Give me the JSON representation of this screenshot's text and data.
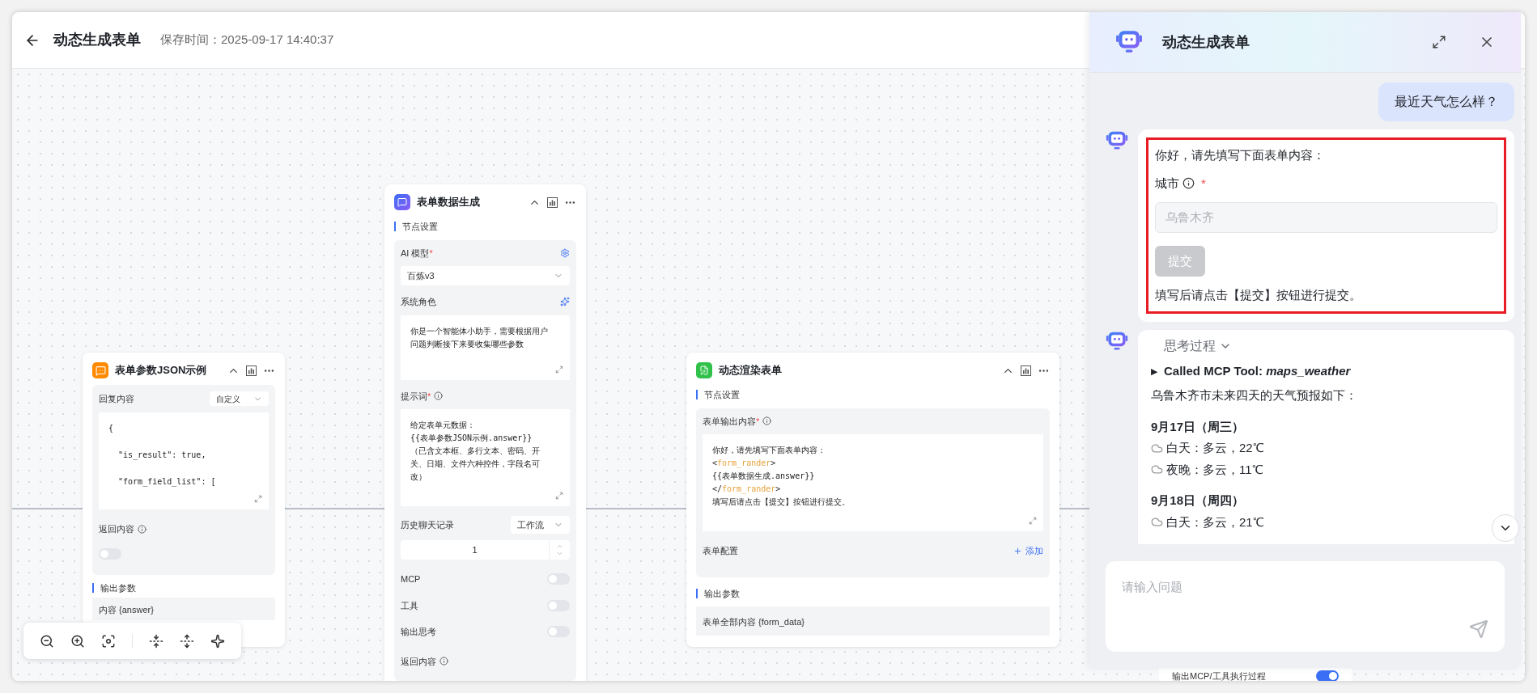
{
  "header": {
    "title": "动态生成表单",
    "saved_time": "保存时间：2025-09-17 14:40:37"
  },
  "json_example_node": {
    "title": "表单参数JSON示例",
    "reply_label": "回复内容",
    "reply_mode": "自定义",
    "code_lines": [
      "{",
      "  \"is_result\": true,",
      "  \"form_field_list\": ["
    ],
    "return_label": "返回内容",
    "return_on": false,
    "output_section": "输出参数",
    "output_param": "内容 {answer}"
  },
  "data_gen_node": {
    "title": "表单数据生成",
    "section": "节点设置",
    "model_label": "AI 模型",
    "model_required": "*",
    "model": "百炼v3",
    "role_label": "系统角色",
    "role_text": "你是一个智能体小助手，需要根据用户问题判断接下来要收集哪些参数",
    "prompt_label": "提示词",
    "prompt_required": "*",
    "prompt_lines": [
      "给定表单元数据：",
      "{{表单参数JSON示例.answer}}",
      "（已含文本框、多行文本、密码、开关、日期、文件六种控件，字段名可改）"
    ],
    "history_label": "历史聊天记录",
    "history_mode": "工作流",
    "history_count": "1",
    "switches": [
      {
        "label": "MCP",
        "on": false
      },
      {
        "label": "工具",
        "on": false
      },
      {
        "label": "输出思考",
        "on": false
      }
    ],
    "return_label": "返回内容"
  },
  "render_node": {
    "title": "动态渲染表单",
    "section": "节点设置",
    "content_label": "表单输出内容",
    "content_required": "*",
    "content_lines": [
      [
        {
          "text": "你好，请先填写下面表单内容：",
          "highlight": false
        }
      ],
      [
        {
          "text": "<",
          "highlight": false
        },
        {
          "text": "form_rander",
          "highlight": true
        },
        {
          "text": ">",
          "highlight": false
        }
      ],
      [
        {
          "text": "{{表单数据生成.answer}}",
          "highlight": false
        }
      ],
      [
        {
          "text": "</",
          "highlight": false
        },
        {
          "text": "form_rander",
          "highlight": true
        },
        {
          "text": ">",
          "highlight": false
        }
      ],
      [
        {
          "text": "填写后请点击【提交】按钮进行提交。",
          "highlight": false
        }
      ]
    ],
    "config_label": "表单配置",
    "add_label": "添加",
    "output_section": "输出参数",
    "output_param": "表单全部内容 {form_data}"
  },
  "hidden_node": {
    "switch_label": "输出MCP/工具执行过程",
    "on": true
  },
  "chat": {
    "title": "动态生成表单",
    "messages": [
      {
        "kind": "user",
        "text": "最近天气怎么样？"
      },
      {
        "kind": "form",
        "highlighted": true,
        "intro": "你好，请先填写下面表单内容：",
        "field": {
          "label": "城市",
          "required_mark": "*",
          "value": "乌鲁木齐",
          "disabled": true
        },
        "submit": {
          "label": "提交",
          "disabled": true
        },
        "outro": "填写后请点击【提交】按钮进行提交。"
      },
      {
        "kind": "weather",
        "thinking_label": "思考过程",
        "tool_marker": "▶",
        "tool_call": "Called MCP Tool: *maps_weather*",
        "intro": "乌鲁木齐市未来四天的天气预报如下：",
        "days": [
          {
            "date": "9月17日（周三）",
            "lines": [
              "白天：多云，22℃",
              "夜晚：多云，11℃"
            ]
          },
          {
            "date": "9月18日（周四）",
            "lines": [
              "白天：多云，21℃"
            ]
          }
        ]
      }
    ],
    "input_placeholder": "请输入问题"
  }
}
